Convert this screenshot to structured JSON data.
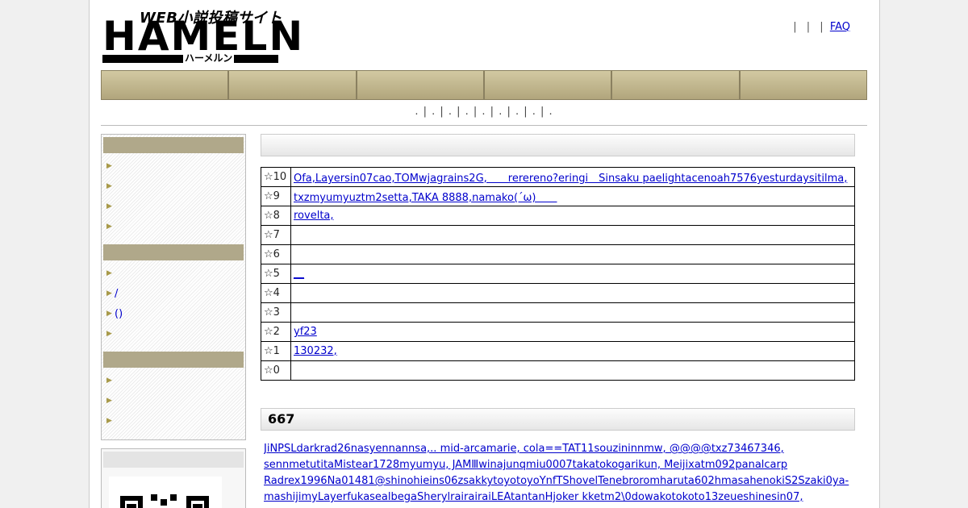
{
  "header": {
    "logo_tagline": "WEB小説投稿サイト",
    "logo_word": "HAMELN",
    "logo_kana": "ハーメルン",
    "toplinks": {
      "sep1": "|",
      "sep2": "|",
      "sep3": "|",
      "faq": "FAQ"
    }
  },
  "nav": {
    "items": [
      "",
      "",
      "",
      "",
      "",
      ""
    ]
  },
  "subnav": {
    "text": ". | . | . | . | . | . | . | . | ."
  },
  "sidebar": {
    "sections": [
      {
        "items": [
          "",
          "",
          "",
          ""
        ]
      },
      {
        "items": [
          "",
          "/",
          "()",
          ""
        ]
      },
      {
        "items": [
          "",
          "",
          ""
        ]
      }
    ]
  },
  "ratings": {
    "rows": [
      {
        "star": "☆10",
        "names": "Ofa,Layersin07cao,TOMwjagrains2G,　　rerereno?eringi　Sinsaku paelightacenoah7576yesturdaysitilma,"
      },
      {
        "star": "☆9",
        "names": "txzmyumyuztm2setta,TAKA 8888,namako(´ω)　　"
      },
      {
        "star": "☆8",
        "names": "rovelta,"
      },
      {
        "star": "☆7",
        "names": ""
      },
      {
        "star": "☆6",
        "names": ""
      },
      {
        "star": "☆5",
        "names": "__"
      },
      {
        "star": "☆4",
        "names": ""
      },
      {
        "star": "☆3",
        "names": ""
      },
      {
        "star": "☆2",
        "names": "yf23"
      },
      {
        "star": "☆1",
        "names": "130232,"
      },
      {
        "star": "☆0",
        "names": ""
      }
    ]
  },
  "count": {
    "value": "667"
  },
  "names_list": {
    "lines": [
      "JiNPSLdarkrad26nasyennannsa,..  mid-arcamarie,    cola==TAT11souzininnmw,  @@@@txz73467346,",
      "sennmetutitaMistear1728myumyu,   JAMⅢwinajunqmiu0007takatokogarikun,   Meijixatm092panalcarp",
      "Radrex1996Na01481@shinohieins06zsakkytoyotoyoYnfTShovelTenebroromharuta602hmasahenokiS2Szaki0ya-",
      "mashijimyLayerfukasealbegaSherylrairairaiLEAtantanHjoker      kketm2\\0dowakotokoto13zeueshinesin07,"
    ]
  },
  "colors": {
    "nav_bg": "#c3b88f",
    "side_head": "#b0a88a",
    "link": "#0000cc"
  }
}
